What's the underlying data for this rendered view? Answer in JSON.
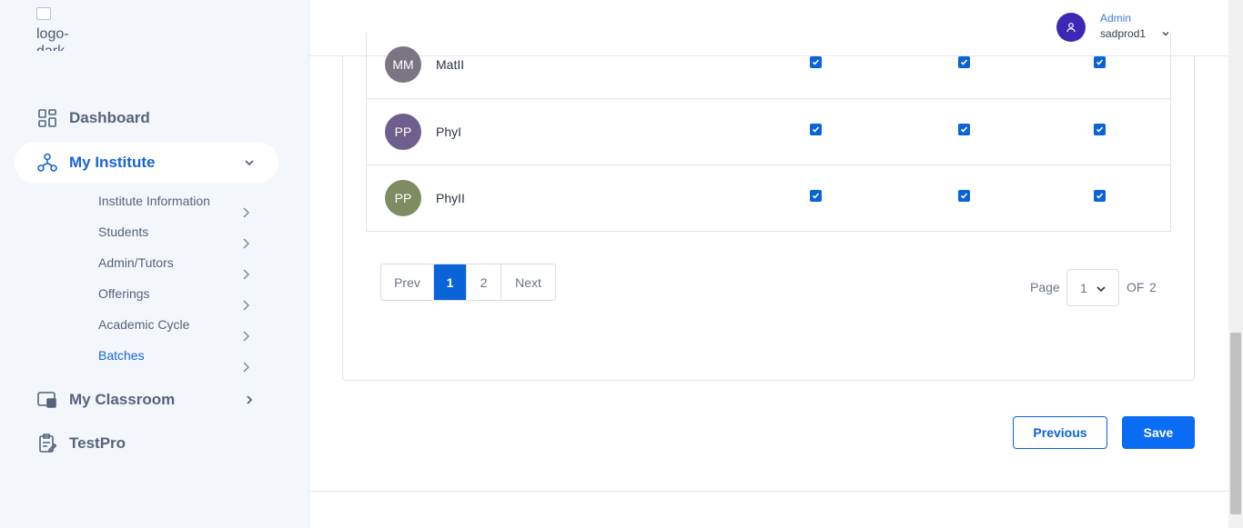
{
  "logo": {
    "alt_text": "logo-dark"
  },
  "header": {
    "user_role": "Admin",
    "user_name": "sadprod1"
  },
  "sidebar": {
    "items": [
      {
        "label": "Dashboard",
        "icon": "dashboard-icon"
      },
      {
        "label": "My Institute",
        "icon": "institute-icon",
        "expanded": true
      },
      {
        "label": "My Classroom",
        "icon": "classroom-icon"
      },
      {
        "label": "TestPro",
        "icon": "testpro-icon"
      }
    ],
    "institute_subitems": [
      {
        "label": "Institute Information"
      },
      {
        "label": "Students"
      },
      {
        "label": "Admin/Tutors"
      },
      {
        "label": "Offerings"
      },
      {
        "label": "Academic Cycle"
      },
      {
        "label": "Batches",
        "active": true
      }
    ]
  },
  "table": {
    "rows": [
      {
        "initials": "MM",
        "name": "MatII",
        "checks": [
          true,
          true,
          true
        ],
        "avatar_color": "#7a7582"
      },
      {
        "initials": "PP",
        "name": "PhyI",
        "checks": [
          true,
          true,
          true
        ],
        "avatar_color": "#6e5f8c"
      },
      {
        "initials": "PP",
        "name": "PhyII",
        "checks": [
          true,
          true,
          true
        ],
        "avatar_color": "#7f8c62"
      }
    ]
  },
  "pagination": {
    "prev_label": "Prev",
    "pages": [
      "1",
      "2"
    ],
    "current_page": "1",
    "next_label": "Next",
    "page_label": "Page",
    "selected_page": "1",
    "of_label": "OF",
    "total_pages": "2"
  },
  "actions": {
    "previous_label": "Previous",
    "save_label": "Save"
  },
  "colors": {
    "accent": "#0a63d8",
    "sidebar_bg": "#f3f6fb",
    "avatar_bg": "#3b29b6"
  }
}
